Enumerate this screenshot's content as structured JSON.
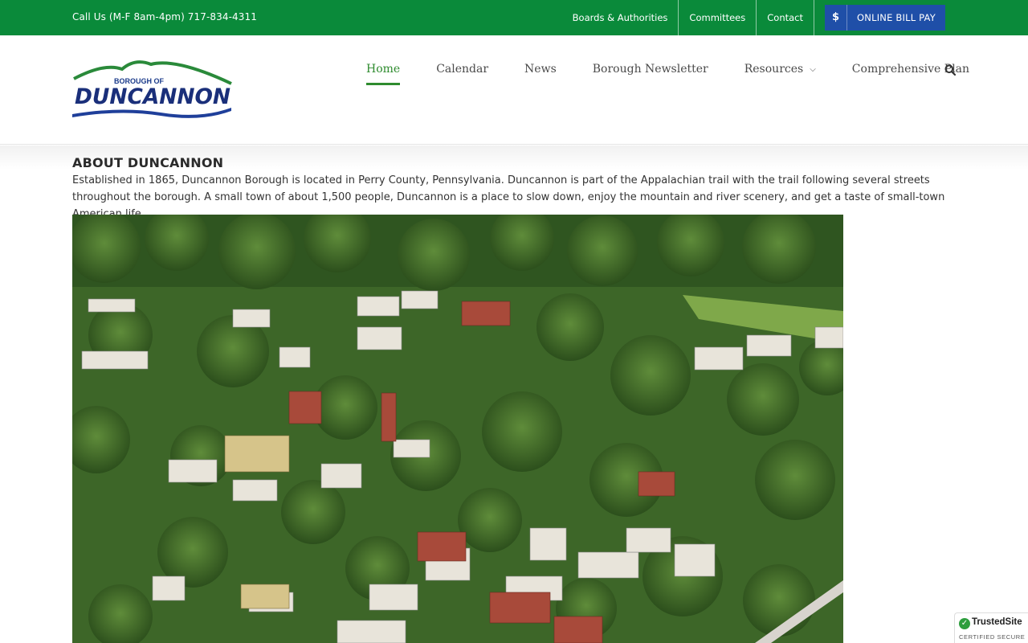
{
  "topbar": {
    "phone": "Call Us (M-F 8am-4pm) 717-834-4311",
    "links": [
      "Boards & Authorities",
      "Committees",
      "Contact"
    ],
    "billpay": {
      "icon": "dollar-icon",
      "symbol": "$",
      "label": "ONLINE BILL PAY"
    },
    "colors": {
      "bar": "#0a8a3a",
      "billpay": "#1f4fa8"
    }
  },
  "logo": {
    "small_text": "BOROUGH OF",
    "name": "DUNCANNON"
  },
  "nav": {
    "items": [
      {
        "label": "Home",
        "active": true
      },
      {
        "label": "Calendar"
      },
      {
        "label": "News"
      },
      {
        "label": "Borough Newsletter"
      },
      {
        "label": "Resources",
        "dropdown": true
      },
      {
        "label": "Comprehensive Plan"
      }
    ],
    "search_icon": "search-icon",
    "active_color": "#2e8b2e"
  },
  "main": {
    "title": "ABOUT DUNCANNON",
    "text": "Established in 1865, Duncannon Borough is located in Perry County, Pennsylvania. Duncannon is part of the Appalachian trail with the trail following several streets throughout the borough. A small town of about 1,500 people, Duncannon is a place to slow down, enjoy the mountain and river scenery, and get a taste of small-town American life."
  },
  "badge": {
    "name": "TrustedSite",
    "sub": "CERTIFIED SECURE"
  }
}
